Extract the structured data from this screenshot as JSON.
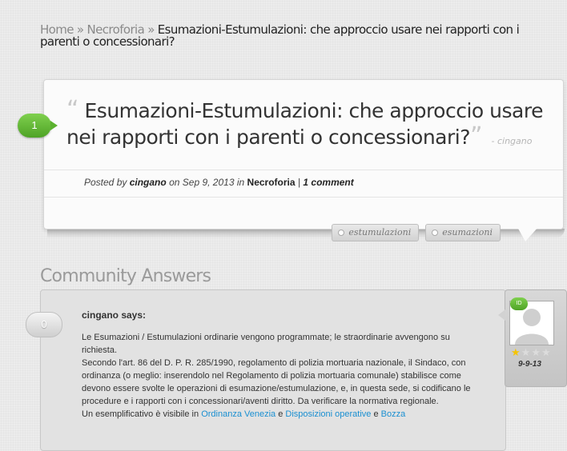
{
  "breadcrumb": {
    "home": "Home",
    "separator": "»",
    "category": "Necroforia",
    "current": "Esumazioni-Estumulazioni: che approccio usare nei rapporti con i parenti o concessionari?"
  },
  "question": {
    "number": "1",
    "open_quote": "“",
    "close_quote": "”",
    "title": "Esumazioni-Estumulazioni: che approccio usare nei rapporti con i parenti o concessionari?",
    "author_tag": "- cingano",
    "meta": {
      "posted_by_label": "Posted by",
      "author": "cingano",
      "on_label": "on",
      "date": "Sep 9, 2013",
      "in_label": "in",
      "category": "Necroforia",
      "divider": "|",
      "comments": "1 comment"
    },
    "tags": [
      "estumulazioni",
      "esumazioni"
    ]
  },
  "answers_section": {
    "title": "Community Answers"
  },
  "answer": {
    "number": "0",
    "author_line": "cingano says:",
    "paragraphs": [
      "Le Esumazioni / Estumulazioni ordinarie vengono programmate; le straordinarie avvengono su richiesta.",
      "Secondo l'art. 86 del D. P. R. 285/1990, regolamento di polizia mortuaria nazionale, il Sindaco, con ordinanza (o meglio: inserendolo nel Regolamento di polizia mortuaria comunale) stabilisce come devono essere svolte le operazioni di esumazione/estumulazione, e, in questa sede, si codificano le procedure e i rapporti con i concessionari/aventi diritto. Da verificare la normativa regionale."
    ],
    "last_line_prefix": "Un esemplificativo è visibile in",
    "link1": "Ordinanza Venezia",
    "and1": "e",
    "link2": "Disposizioni operative",
    "and2": "e",
    "link3": "Bozza",
    "badge": "ID",
    "rating": 1,
    "rating_max": 4,
    "date": "9-9-13"
  },
  "colors": {
    "green_badge": "#5bb12f",
    "link_blue": "#1a8fd1",
    "star_on": "#f5c400"
  }
}
